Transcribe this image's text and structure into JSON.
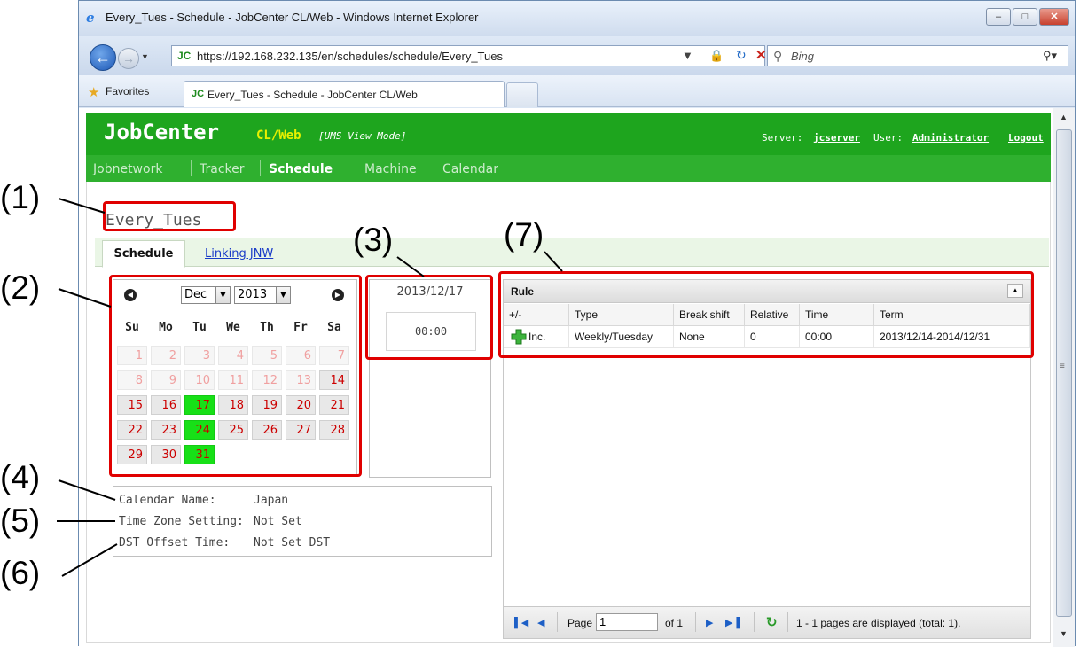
{
  "browser": {
    "title": "Every_Tues - Schedule - JobCenter CL/Web - Windows Internet Explorer",
    "address_prefix": "JC",
    "url": "https://192.168.232.135/en/schedules/schedule/Every_Tues",
    "search_placeholder": "Bing",
    "favorites_label": "Favorites",
    "tab_prefix": "JC",
    "tab_title": "Every_Tues - Schedule - JobCenter CL/Web"
  },
  "app": {
    "brand": "JobCenter",
    "brand_sub": "CL/Web",
    "mode": "[UMS View Mode]",
    "server_label": "Server:",
    "server": "jcserver",
    "user_label": "User:",
    "user": "Administrator",
    "logout": "Logout"
  },
  "menu": [
    {
      "label": "Jobnetwork",
      "active": false
    },
    {
      "label": "Tracker",
      "active": false
    },
    {
      "label": "Schedule",
      "active": true
    },
    {
      "label": "Machine",
      "active": false
    },
    {
      "label": "Calendar",
      "active": false
    }
  ],
  "schedule": {
    "name": "Every_Tues",
    "tabs": [
      {
        "label": "Schedule",
        "active": true
      },
      {
        "label": "Linking JNW",
        "active": false
      }
    ]
  },
  "calendar": {
    "month": "Dec",
    "year": "2013",
    "weekdays": [
      "Su",
      "Mo",
      "Tu",
      "We",
      "Th",
      "Fr",
      "Sa"
    ],
    "weeks": [
      [
        {
          "d": "1",
          "s": "dim"
        },
        {
          "d": "2",
          "s": "dim"
        },
        {
          "d": "3",
          "s": "dim"
        },
        {
          "d": "4",
          "s": "dim"
        },
        {
          "d": "5",
          "s": "dim"
        },
        {
          "d": "6",
          "s": "dim"
        },
        {
          "d": "7",
          "s": "dim"
        }
      ],
      [
        {
          "d": "8",
          "s": "dim"
        },
        {
          "d": "9",
          "s": "dim"
        },
        {
          "d": "10",
          "s": "dim"
        },
        {
          "d": "11",
          "s": "dim"
        },
        {
          "d": "12",
          "s": "dim"
        },
        {
          "d": "13",
          "s": "dim"
        },
        {
          "d": "14",
          "s": "cur"
        }
      ],
      [
        {
          "d": "15",
          "s": "cur"
        },
        {
          "d": "16",
          "s": "cur"
        },
        {
          "d": "17",
          "s": "sel"
        },
        {
          "d": "18",
          "s": "cur"
        },
        {
          "d": "19",
          "s": "cur"
        },
        {
          "d": "20",
          "s": "cur"
        },
        {
          "d": "21",
          "s": "cur"
        }
      ],
      [
        {
          "d": "22",
          "s": "cur"
        },
        {
          "d": "23",
          "s": "cur"
        },
        {
          "d": "24",
          "s": "sel"
        },
        {
          "d": "25",
          "s": "cur"
        },
        {
          "d": "26",
          "s": "cur"
        },
        {
          "d": "27",
          "s": "cur"
        },
        {
          "d": "28",
          "s": "cur"
        }
      ],
      [
        {
          "d": "29",
          "s": "cur"
        },
        {
          "d": "30",
          "s": "cur"
        },
        {
          "d": "31",
          "s": "sel"
        }
      ]
    ]
  },
  "selected_date": {
    "date": "2013/12/17",
    "time": "00:00"
  },
  "info": {
    "calendar_label": "Calendar Name:",
    "calendar_value": "Japan",
    "timezone_label": "Time Zone Setting:",
    "timezone_value": "Not Set",
    "dst_label": "DST Offset Time:",
    "dst_value": "Not Set DST"
  },
  "rule": {
    "title": "Rule",
    "columns": [
      "+/-",
      "Type",
      "Break shift",
      "Relative",
      "Time",
      "Term"
    ],
    "rows": [
      [
        "Inc.",
        "Weekly/Tuesday",
        "None",
        "0",
        "00:00",
        "2013/12/14-2014/12/31"
      ]
    ],
    "pager": {
      "page_label": "Page",
      "page_value": "1",
      "of_label": "of 1",
      "status": "1 - 1 pages are displayed (total: 1)."
    }
  },
  "annotations": [
    "(1)",
    "(2)",
    "(3)",
    "(4)",
    "(5)",
    "(6)",
    "(7)"
  ]
}
